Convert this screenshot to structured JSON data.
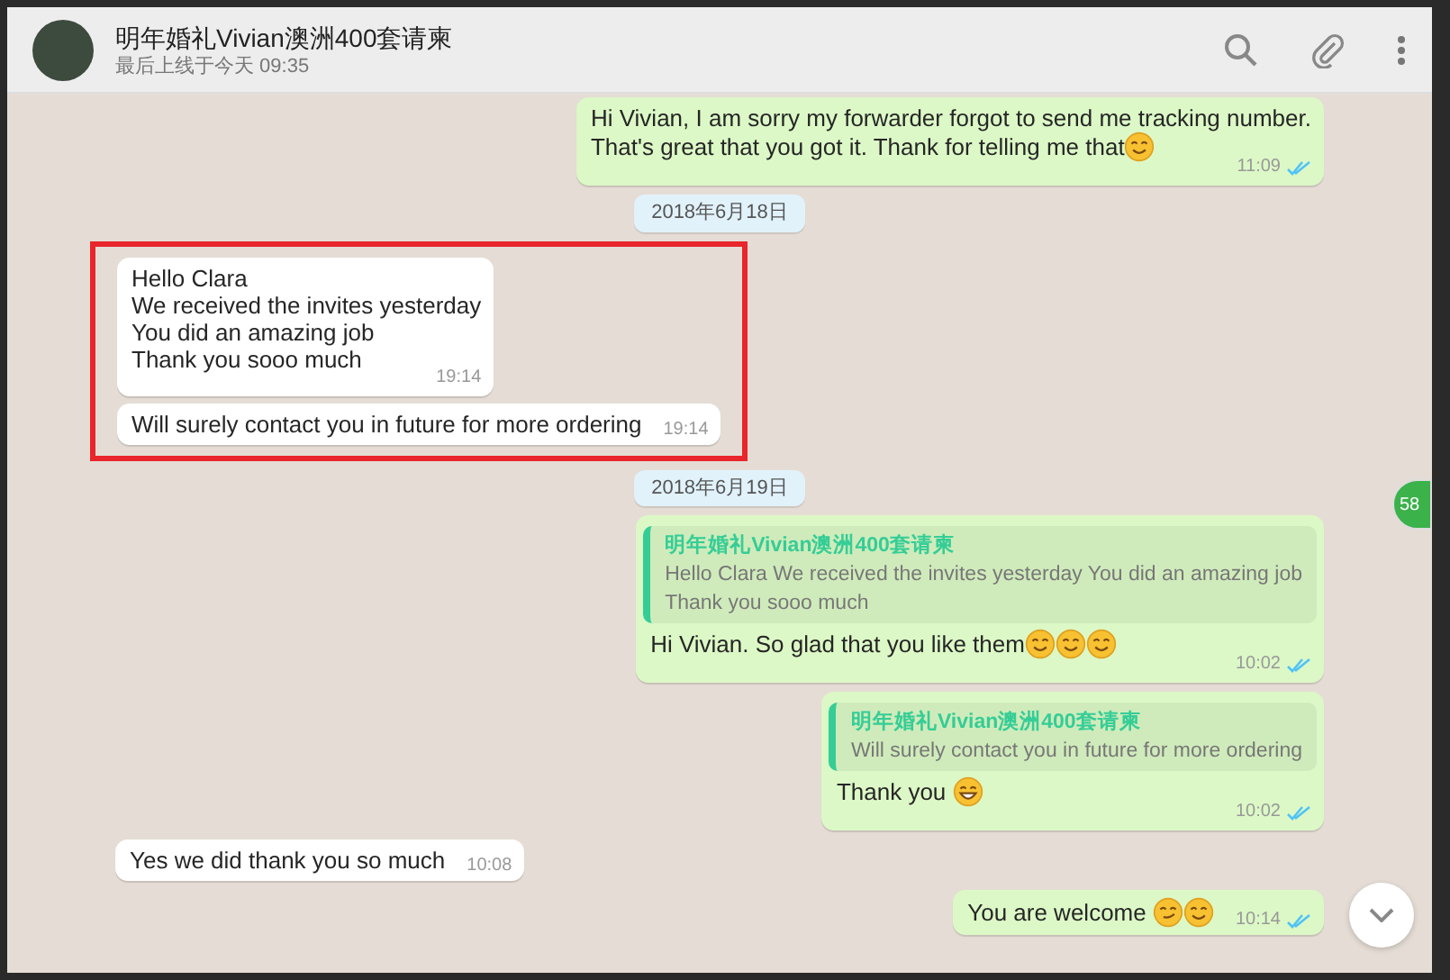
{
  "header": {
    "title": "明年婚礼Vivian澳洲400套请柬",
    "status": "最后上线于今天 09:35"
  },
  "messages": [
    {
      "kind": "out",
      "lines": [
        "Hi Vivian, I am sorry my forwarder forgot to send me tracking number.",
        "That's great that you got it. Thank for telling me that"
      ],
      "emojis": [
        {
          "kind": "smile"
        }
      ],
      "time": "11:09",
      "read": true,
      "highlighted": false
    },
    {
      "kind": "date",
      "text": "2018年6月18日",
      "highlighted": false
    },
    {
      "kind": "in",
      "lines": [
        "Hello Clara",
        "We received the invites yesterday",
        "You did an amazing job",
        "Thank you sooo much"
      ],
      "time": "19:14",
      "highlighted": true
    },
    {
      "kind": "in",
      "lines": [
        "Will surely contact you in future for more ordering"
      ],
      "time": "19:14",
      "highlighted": true
    },
    {
      "kind": "date",
      "text": "2018年6月19日",
      "highlighted": false
    },
    {
      "kind": "out",
      "quote": {
        "author": "明年婚礼Vivian澳洲400套请柬",
        "lines": [
          "Hello Clara We received the invites yesterday You did an amazing job",
          "Thank you sooo much"
        ]
      },
      "lines": [
        "Hi Vivian. So glad that you like them"
      ],
      "emojis": [
        {
          "kind": "smile"
        },
        {
          "kind": "smile"
        },
        {
          "kind": "smile"
        }
      ],
      "time": "10:02",
      "read": true,
      "highlighted": false
    },
    {
      "kind": "out",
      "quote": {
        "author": "明年婚礼Vivian澳洲400套请柬",
        "lines": [
          "Will surely contact you in future for more ordering"
        ]
      },
      "lines": [
        "Thank you "
      ],
      "emojis": [
        {
          "kind": "grin"
        }
      ],
      "time": "10:02",
      "read": true,
      "highlighted": false
    },
    {
      "kind": "in",
      "lines": [
        "Yes we did thank you so much"
      ],
      "time": "10:08",
      "highlighted": false
    },
    {
      "kind": "out",
      "lines": [
        "You are welcome "
      ],
      "emojis": [
        {
          "kind": "smirk"
        },
        {
          "kind": "smile"
        }
      ],
      "time": "10:14",
      "read": true,
      "highlighted": false
    }
  ],
  "side_badge": "58"
}
